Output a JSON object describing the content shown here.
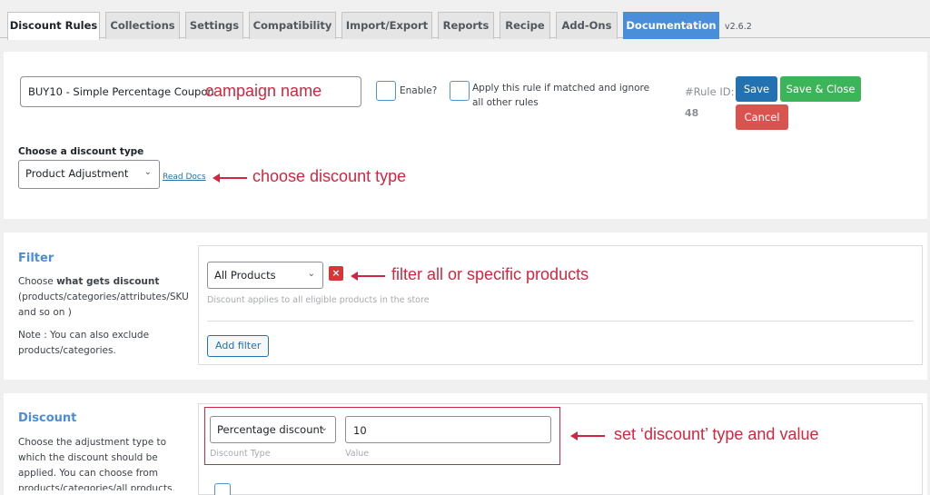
{
  "tabs": [
    {
      "label": "Discount Rules"
    },
    {
      "label": "Collections"
    },
    {
      "label": "Settings"
    },
    {
      "label": "Compatibility"
    },
    {
      "label": "Import/Export"
    },
    {
      "label": "Reports"
    },
    {
      "label": "Recipe"
    },
    {
      "label": "Add-Ons"
    },
    {
      "label": "Documentation"
    }
  ],
  "version": "v2.6.2",
  "rule": {
    "campaign_name": "BUY10 - Simple Percentage Coupon",
    "campaign_annotation": "campaign name",
    "enable_label": "Enable?",
    "apply_label": "Apply this rule if matched and ignore all other rules",
    "rule_id_label": "#Rule ID:",
    "rule_id": "48",
    "save_label": "Save",
    "save_close_label": "Save & Close",
    "cancel_label": "Cancel",
    "discount_type_heading": "Choose a discount type",
    "discount_type_value": "Product Adjustment",
    "read_docs": "Read Docs",
    "discount_type_annotation": "choose discount type"
  },
  "filter": {
    "title": "Filter",
    "desc_prefix": "Choose ",
    "desc_bold": "what gets discount",
    "desc_rest": "(products/categories/attributes/SKU and so on )",
    "note": "Note : You can also exclude products/categories.",
    "select_value": "All Products",
    "remove_icon": "×",
    "hint": "Discount applies to all eligible products in the store",
    "add_filter": "Add filter",
    "annotation": "filter all or specific products"
  },
  "discount": {
    "title": "Discount",
    "desc": "Choose the adjustment type to which the discount should be applied. You can choose from products/categories/all products.",
    "type_value": "Percentage discount",
    "type_label": "Discount Type",
    "value": "10",
    "value_label": "Value",
    "annotation": "set ‘discount’ type and value"
  },
  "colors": {
    "accent": "#4a8ed9",
    "annotation": "#d0263f",
    "save": "#2271b1",
    "save_close": "#3cb45a",
    "cancel": "#d9534f"
  }
}
